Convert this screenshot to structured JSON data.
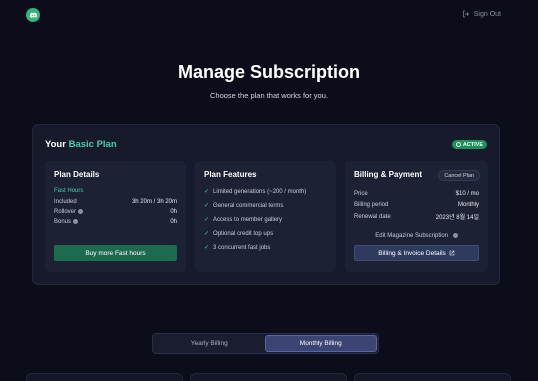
{
  "header": {
    "sign_out_label": "Sign Out"
  },
  "hero": {
    "title": "Manage Subscription",
    "subtitle": "Choose the plan that works for you."
  },
  "plan_card": {
    "your_label": "Your",
    "plan_name": "Basic Plan",
    "status_badge": "ACTIVE"
  },
  "plan_details": {
    "title": "Plan Details",
    "section_label": "Fast Hours",
    "rows": [
      {
        "label": "Included",
        "value": "3h 20m / 3h 20m"
      },
      {
        "label": "Rollover",
        "value": "0h"
      },
      {
        "label": "Bonus",
        "value": "0h"
      }
    ],
    "buy_button": "Buy more Fast hours"
  },
  "plan_features": {
    "title": "Plan Features",
    "items": [
      "Limited generations (~200 / month)",
      "General commercial terms",
      "Access to member gallery",
      "Optional credit top ups",
      "3 concurrent fast jobs"
    ]
  },
  "billing": {
    "title": "Billing & Payment",
    "cancel_button": "Cancel Plan",
    "rows": [
      {
        "label": "Price",
        "value": "$10 / mo"
      },
      {
        "label": "Billing period",
        "value": "Monthly"
      },
      {
        "label": "Renewal date",
        "value": "2023년 8월 14일"
      }
    ],
    "edit_magazine": "Edit Magazine Subscription",
    "invoice_button": "Billing & Invoice Details"
  },
  "billing_toggle": {
    "options": [
      "Yearly Billing",
      "Monthly Billing"
    ],
    "selected": "Monthly Billing"
  },
  "colors": {
    "accent": "#3fd0ad",
    "brand_green": "#2fb87a",
    "background": "#0b0d1a"
  }
}
